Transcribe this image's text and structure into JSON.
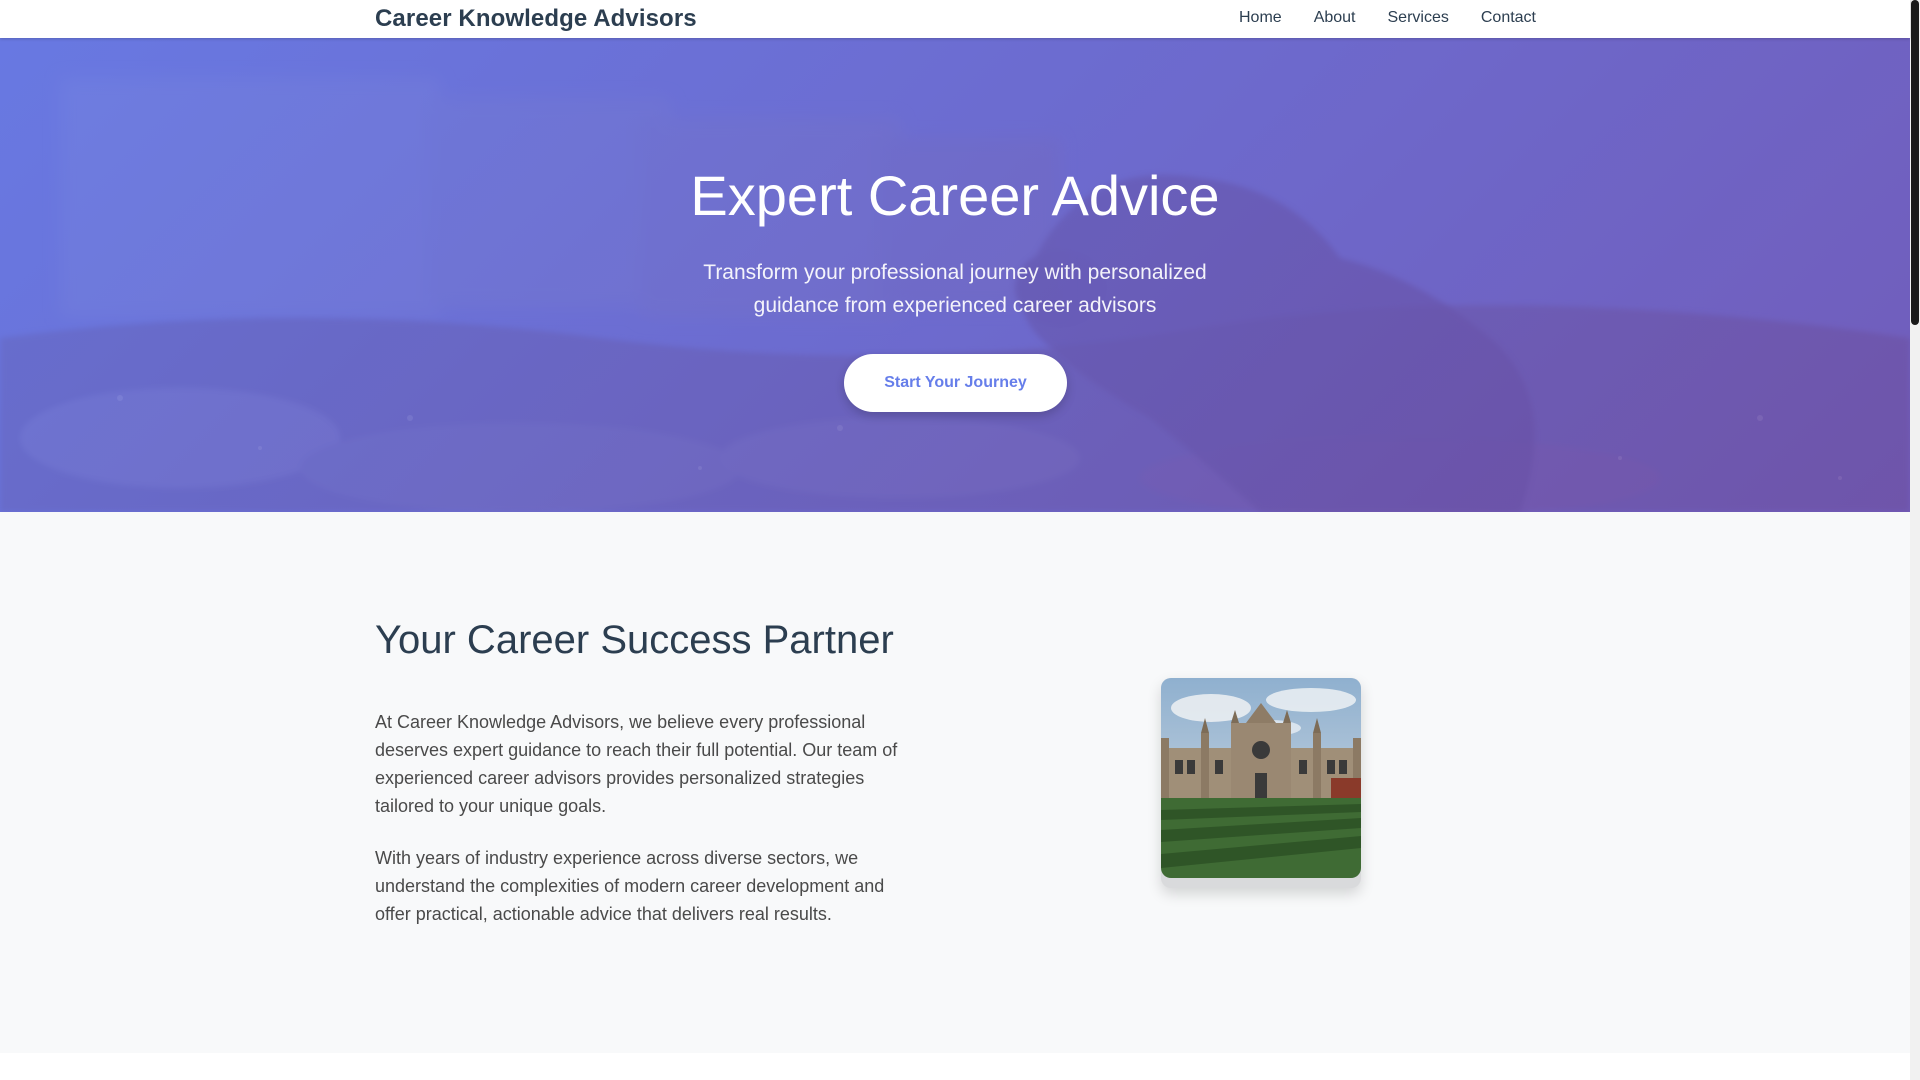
{
  "navbar": {
    "brand": "Career Knowledge Advisors",
    "links": [
      "Home",
      "About",
      "Services",
      "Contact"
    ]
  },
  "hero": {
    "title": "Expert Career Advice",
    "subtitle": "Transform your professional journey with personalized guidance from experienced career advisors",
    "cta_label": "Start Your Journey"
  },
  "about": {
    "title": "Your Career Success Partner",
    "paragraph_1": "At Career Knowledge Advisors, we believe every professional deserves expert guidance to reach their full potential. Our team of experienced career advisors provides personalized strategies tailored to your unique goals.",
    "paragraph_2": "With years of industry experience across diverse sectors, we understand the complexities of modern career development and offer practical, actionable advice that delivers real results."
  },
  "colors": {
    "brand_text": "#2c3e50",
    "hero_start": "#667eea",
    "hero_end": "#764ba2",
    "cta_text": "#667eea",
    "section_bg": "#f8f9fa"
  }
}
